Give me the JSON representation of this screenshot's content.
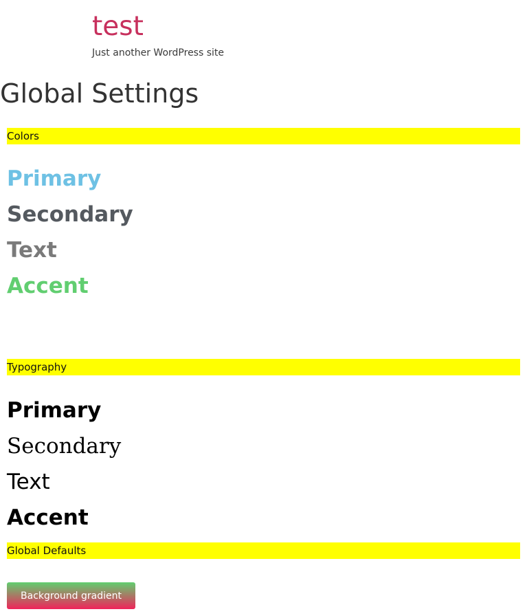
{
  "site": {
    "title": "test",
    "tagline": "Just another WordPress site"
  },
  "page": {
    "title": "Global Settings"
  },
  "colors_section": {
    "heading": "Colors",
    "items": [
      {
        "label": "Primary",
        "color": "#6ec1e4"
      },
      {
        "label": "Secondary",
        "color": "#54595f"
      },
      {
        "label": "Text",
        "color": "#7a7a7a"
      },
      {
        "label": "Accent",
        "color": "#61ce70"
      }
    ]
  },
  "typography_section": {
    "heading": "Typography",
    "items": [
      {
        "label": "Primary"
      },
      {
        "label": "Secondary"
      },
      {
        "label": "Text"
      },
      {
        "label": "Accent"
      }
    ]
  },
  "defaults_section": {
    "heading": "Global Defaults",
    "button_label": "Background gradient",
    "gradient_start": "#61ce70",
    "gradient_end": "#f0245a"
  },
  "theme": {
    "site_title_color": "#c7305d",
    "highlight_color": "#ffff00"
  }
}
